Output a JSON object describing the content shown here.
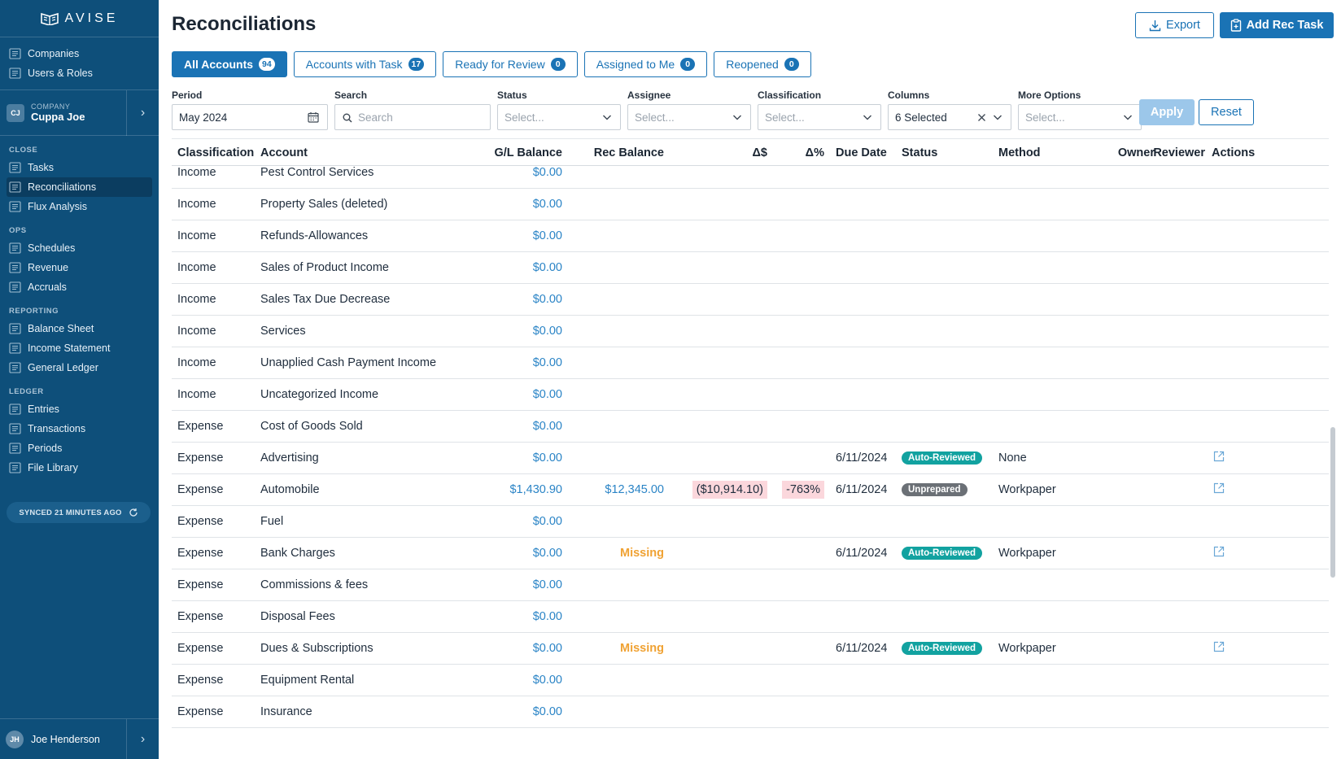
{
  "brand": {
    "logo_text": "AVISE"
  },
  "sidebar": {
    "admin": [
      {
        "label": "Companies",
        "icon": "building-icon"
      },
      {
        "label": "Users & Roles",
        "icon": "users-icon"
      }
    ],
    "company": {
      "initials": "CJ",
      "label": "COMPANY",
      "name": "Cuppa Joe"
    },
    "sections": [
      {
        "title": "CLOSE",
        "items": [
          {
            "label": "Tasks",
            "icon": "tasks-icon"
          },
          {
            "label": "Reconciliations",
            "icon": "reconciliations-icon",
            "active": true
          },
          {
            "label": "Flux Analysis",
            "icon": "chart-icon"
          }
        ]
      },
      {
        "title": "OPS",
        "items": [
          {
            "label": "Schedules",
            "icon": "calendar-icon"
          },
          {
            "label": "Revenue",
            "icon": "revenue-icon"
          },
          {
            "label": "Accruals",
            "icon": "accruals-icon"
          }
        ]
      },
      {
        "title": "REPORTING",
        "items": [
          {
            "label": "Balance Sheet",
            "icon": "scale-icon"
          },
          {
            "label": "Income Statement",
            "icon": "statement-icon"
          },
          {
            "label": "General Ledger",
            "icon": "book-icon"
          }
        ]
      },
      {
        "title": "LEDGER",
        "items": [
          {
            "label": "Entries",
            "icon": "entries-icon"
          },
          {
            "label": "Transactions",
            "icon": "transactions-icon"
          },
          {
            "label": "Periods",
            "icon": "periods-icon"
          },
          {
            "label": "File Library",
            "icon": "file-icon"
          }
        ]
      }
    ],
    "synced": "SYNCED 21 MINUTES AGO",
    "user": {
      "initials": "JH",
      "name": "Joe Henderson"
    }
  },
  "header": {
    "title": "Reconciliations",
    "export_label": "Export",
    "add_label": "Add Rec Task"
  },
  "tabs": [
    {
      "label": "All Accounts",
      "count": "94",
      "active": true
    },
    {
      "label": "Accounts with Task",
      "count": "17"
    },
    {
      "label": "Ready for Review",
      "count": "0"
    },
    {
      "label": "Assigned to Me",
      "count": "0"
    },
    {
      "label": "Reopened",
      "count": "0"
    }
  ],
  "filters": {
    "period": {
      "label": "Period",
      "value": "May 2024"
    },
    "search": {
      "label": "Search",
      "placeholder": "Search"
    },
    "status": {
      "label": "Status",
      "placeholder": "Select..."
    },
    "assignee": {
      "label": "Assignee",
      "placeholder": "Select..."
    },
    "classification": {
      "label": "Classification",
      "placeholder": "Select..."
    },
    "columns": {
      "label": "Columns",
      "value": "6 Selected"
    },
    "more": {
      "label": "More Options",
      "placeholder": "Select..."
    },
    "apply_label": "Apply",
    "reset_label": "Reset"
  },
  "table": {
    "columns": [
      "Classification",
      "Account",
      "G/L Balance",
      "Rec Balance",
      "Δ$",
      "Δ%",
      "Due Date",
      "Status",
      "Method",
      "Owner",
      "Reviewer",
      "Actions"
    ],
    "rows": [
      {
        "classification": "Income",
        "account": "Pest Control Services",
        "gl": "$0.00"
      },
      {
        "classification": "Income",
        "account": "Property Sales (deleted)",
        "gl": "$0.00"
      },
      {
        "classification": "Income",
        "account": "Refunds-Allowances",
        "gl": "$0.00"
      },
      {
        "classification": "Income",
        "account": "Sales of Product Income",
        "gl": "$0.00"
      },
      {
        "classification": "Income",
        "account": "Sales Tax Due Decrease",
        "gl": "$0.00"
      },
      {
        "classification": "Income",
        "account": "Services",
        "gl": "$0.00"
      },
      {
        "classification": "Income",
        "account": "Unapplied Cash Payment Income",
        "gl": "$0.00"
      },
      {
        "classification": "Income",
        "account": "Uncategorized Income",
        "gl": "$0.00"
      },
      {
        "classification": "Expense",
        "account": "Cost of Goods Sold",
        "gl": "$0.00"
      },
      {
        "classification": "Expense",
        "account": "Advertising",
        "gl": "$0.00",
        "due": "6/11/2024",
        "status": "Auto-Reviewed",
        "method": "None",
        "action": true
      },
      {
        "classification": "Expense",
        "account": "Automobile",
        "gl": "$1,430.90",
        "rec": "$12,345.00",
        "delta": "($10,914.10)",
        "pct": "-763%",
        "due": "6/11/2024",
        "status": "Unprepared",
        "method": "Workpaper",
        "action": true
      },
      {
        "classification": "Expense",
        "account": "Fuel",
        "gl": "$0.00"
      },
      {
        "classification": "Expense",
        "account": "Bank Charges",
        "gl": "$0.00",
        "rec": "Missing",
        "due": "6/11/2024",
        "status": "Auto-Reviewed",
        "method": "Workpaper",
        "action": true
      },
      {
        "classification": "Expense",
        "account": "Commissions & fees",
        "gl": "$0.00"
      },
      {
        "classification": "Expense",
        "account": "Disposal Fees",
        "gl": "$0.00"
      },
      {
        "classification": "Expense",
        "account": "Dues & Subscriptions",
        "gl": "$0.00",
        "rec": "Missing",
        "due": "6/11/2024",
        "status": "Auto-Reviewed",
        "method": "Workpaper",
        "action": true
      },
      {
        "classification": "Expense",
        "account": "Equipment Rental",
        "gl": "$0.00"
      },
      {
        "classification": "Expense",
        "account": "Insurance",
        "gl": "$0.00"
      }
    ]
  },
  "colors": {
    "sidebar_bg": "#0e4f7a",
    "accent": "#1a73b5",
    "auto_reviewed": "#12a2a0",
    "unprepared": "#6b7076",
    "missing": "#f0a233",
    "negative_bg": "#fbd7dc"
  }
}
